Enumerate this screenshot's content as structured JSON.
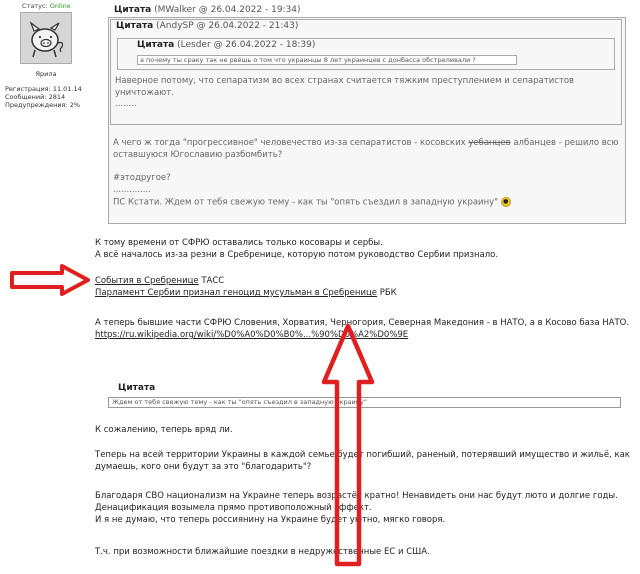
{
  "user": {
    "status_label": "Статус:",
    "status_value": "Online",
    "name": "Ярила",
    "info": [
      "Регистрация: 11.01.14",
      "Сообщений: 2814",
      "Предупреждения: 2%"
    ]
  },
  "quote_label": "Цитата",
  "quote_outer": {
    "meta": "(MWalker @ 26.04.2022 - 19:34)",
    "lines": [
      "А чего ж тогда \"прогрессивное\" человечество из-за сепаратистов - косовских",
      "оставшуюся Югославию разбомбить?",
      "",
      "#этодругое?",
      "..............",
      "ПС Кстати. Ждем от тебя свежую тему - как ты \"опять съездил в западную украину\""
    ],
    "line1_strike": "уебанцев",
    "line1_tail": "албанцев - решило всю",
    "emoji": "cool-icon"
  },
  "quote_middle": {
    "meta": "(AndySP @ 26.04.2022 - 21:43)",
    "lines": [
      "Наверное потому, что сепаратизм во всех странах считается тяжким преступлением и сепаратистов",
      "уничтожают.",
      "........"
    ]
  },
  "quote_inner": {
    "meta": "(Lesder @ 26.04.2022 - 18:39)",
    "text": "а почему ты сраку так не рвёшь о том что украинцы 8 лет украинцев с донбасса обстреливали ?"
  },
  "post": {
    "p1": [
      "К тому времени от СФРЮ оставались только косовары и сербы.",
      "А всё началось из-за резни в Сребренице, которую потом руководство Сербии признало."
    ],
    "link1_text": "События в Сребренице",
    "link1_src": "ТАСС",
    "link2_text": "Парламент Сербии признал геноцид мусульман в Сребренице",
    "link2_src": "РБК",
    "p2": "А теперь бывшие части СФРЮ Словения, Хорватия, Черногория, Северная Македония - в НАТО, а в Косово база НАТО.",
    "wiki_link": "https://ru.wikipedia.org/wiki/%D0%A0%D0%B0%...%90%D0%A2%D0%9E",
    "quote4_text": "Ждем от тебя свежую тему - как ты \"опять съездил в западную украину\"",
    "p3": "К сожалению, теперь вряд ли.",
    "p4": [
      "Теперь на всей территории Украины в каждой семье будет погибший, раненый, потерявший имущество и жильё, как",
      "думаешь, кого они будут за это \"благодарить\"?"
    ],
    "p5": [
      "Благодаря СВО национализм на Украине теперь возрастёт кратно! Ненавидеть они нас будут люто и долгие годы.",
      "Денацификация возымела прямо противоположный эффект.",
      "И я не думаю, что теперь россиянину на Украине будет уютно, мягко говоря."
    ],
    "p6": "Т.ч. при возможности ближайшие поездки в недружественные ЕС и США."
  },
  "colors": {
    "arrow": "#e02020",
    "online": "#2a9a2a",
    "quote_bg": "#f7f7f7",
    "quote_text": "#666666"
  }
}
